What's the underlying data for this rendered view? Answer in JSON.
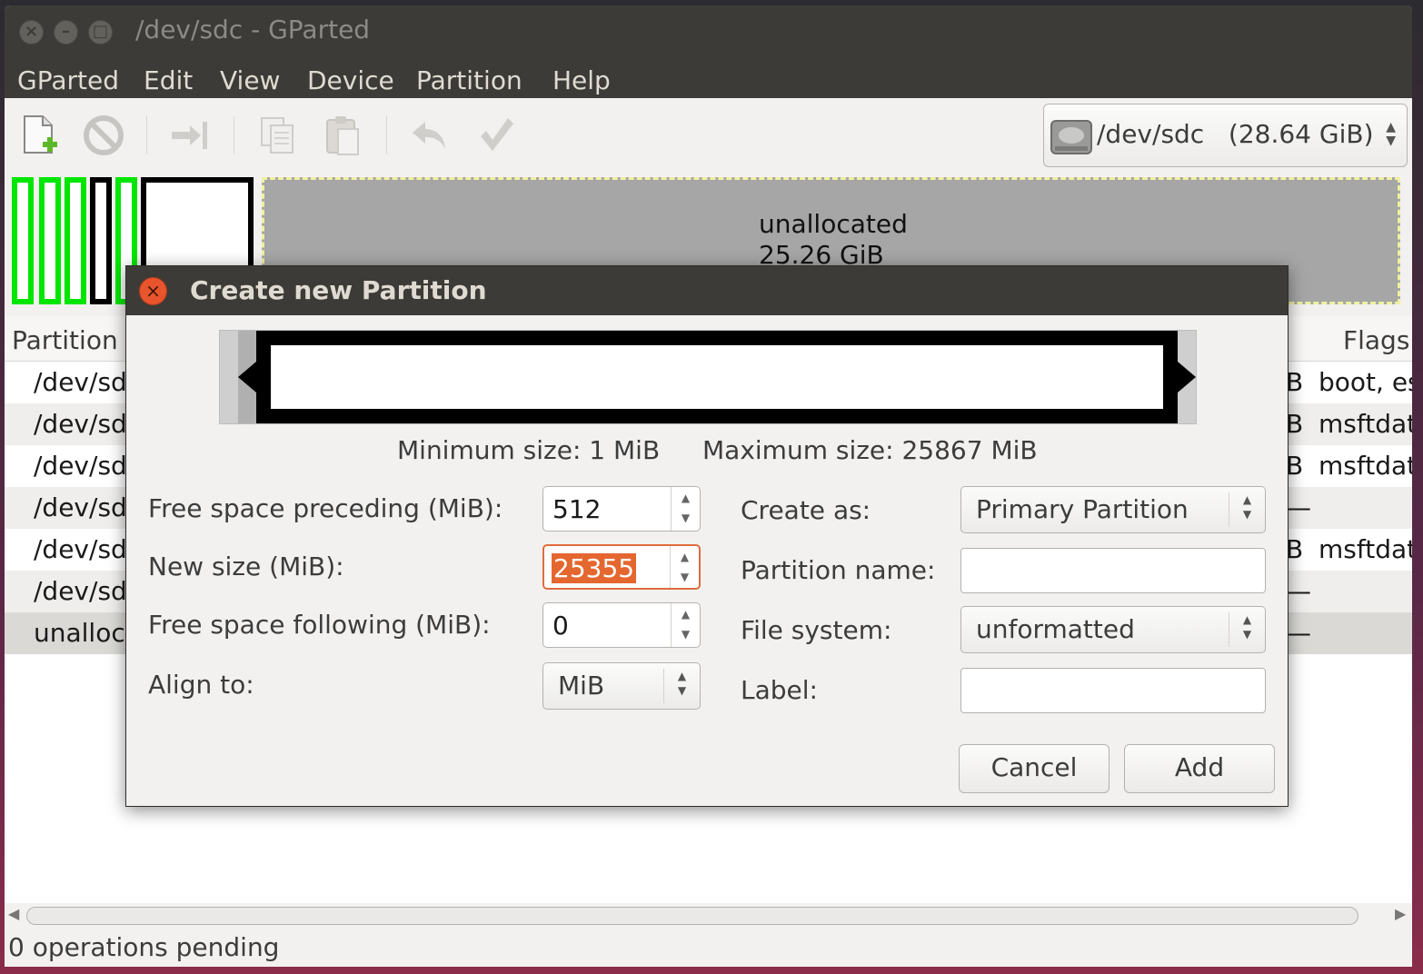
{
  "window": {
    "title": "/dev/sdc - GParted",
    "close_glyph": "×",
    "minimize_glyph": "–",
    "maximize_glyph": "□"
  },
  "menu": [
    "GParted",
    "Edit",
    "View",
    "Device",
    "Partition",
    "Help"
  ],
  "toolbar": {
    "icons": [
      "new-partition-icon",
      "delete-icon",
      "resize-move-icon",
      "copy-icon",
      "paste-icon",
      "undo-icon",
      "apply-icon"
    ],
    "device_selector": "/dev/sdc   (28.64 GiB)"
  },
  "disk_map": {
    "unallocated_label": "unallocated",
    "unallocated_size": "25.26 GiB",
    "colors": {
      "used_partition": "#00e600",
      "unallocated": "#a6a6a6",
      "selection_border": "#000000"
    }
  },
  "partition_list": {
    "headers": {
      "partition": "Partition",
      "flags": "Flags"
    },
    "rows": [
      {
        "device": "/dev/sd",
        "size_tail": "B",
        "flags": "boot, es"
      },
      {
        "device": "/dev/sd",
        "size_tail": "B",
        "flags": "msftdat"
      },
      {
        "device": "/dev/sd",
        "size_tail": "B",
        "flags": "msftdat"
      },
      {
        "device": "/dev/sd",
        "size_tail": "—",
        "flags": ""
      },
      {
        "device": "/dev/sd",
        "size_tail": "B",
        "flags": "msftdat"
      },
      {
        "device": "/dev/sd",
        "size_tail": "—",
        "flags": ""
      },
      {
        "device": "unalloc",
        "size_tail": "—",
        "flags": ""
      }
    ]
  },
  "status": "0 operations pending",
  "dialog": {
    "title": "Create new Partition",
    "close_glyph": "×",
    "min_size": "Minimum size: 1 MiB",
    "max_size": "Maximum size: 25867 MiB",
    "free_preceding_label": "Free space preceding (MiB):",
    "free_preceding_value": "512",
    "new_size_label": "New size (MiB):",
    "new_size_value": "25355",
    "free_following_label": "Free space following (MiB):",
    "free_following_value": "0",
    "align_label": "Align to:",
    "align_value": "MiB",
    "create_as_label": "Create as:",
    "create_as_value": "Primary Partition",
    "partition_name_label": "Partition name:",
    "partition_name_value": "",
    "file_system_label": "File system:",
    "file_system_value": "unformatted",
    "label_label": "Label:",
    "label_value": "",
    "cancel_label": "Cancel",
    "add_label": "Add",
    "colors": {
      "accent": "#e4672f",
      "close": "#e8542c"
    }
  }
}
